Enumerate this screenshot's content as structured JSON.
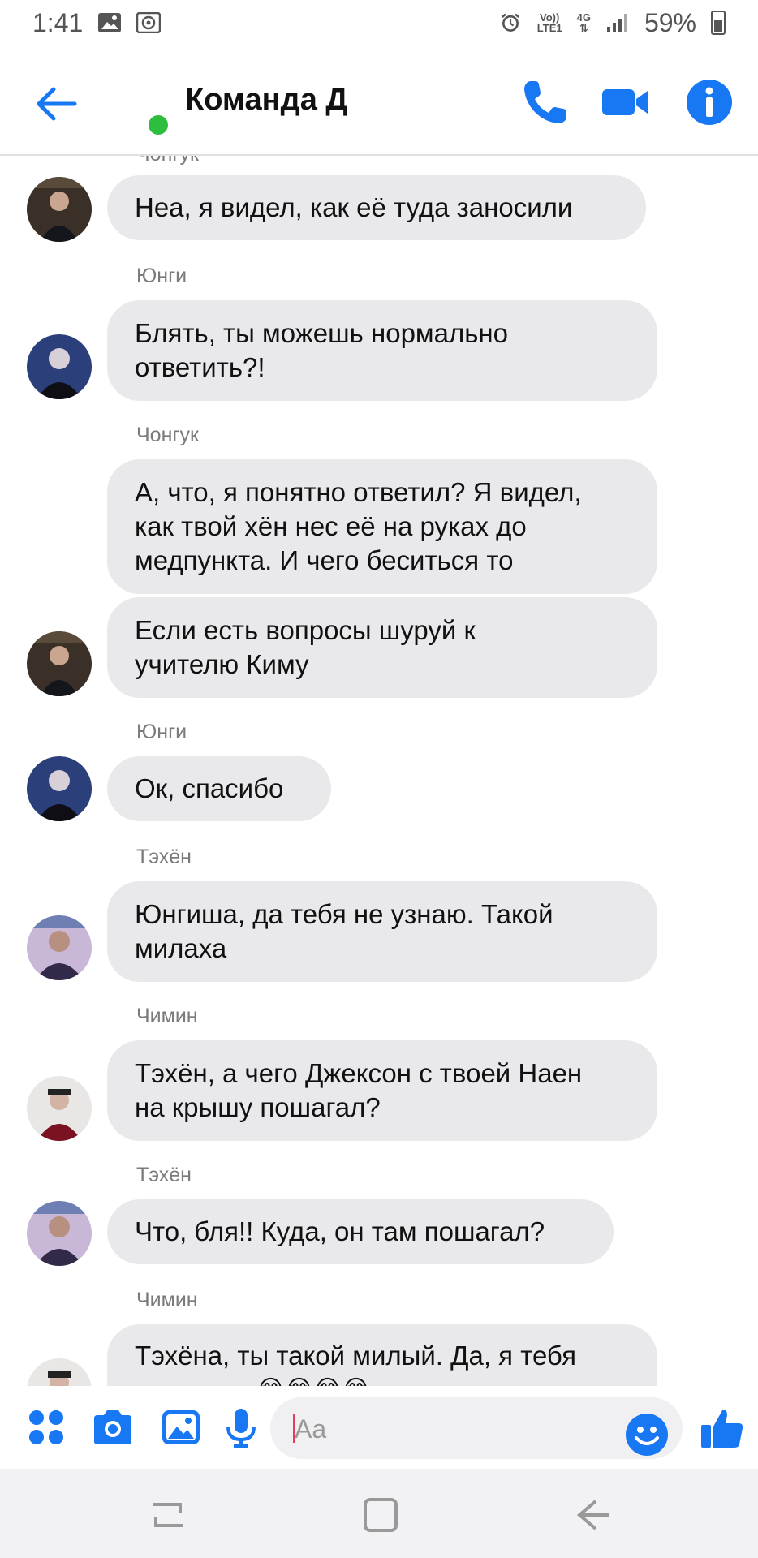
{
  "status_bar": {
    "time": "1:41",
    "net_top": "Vo))",
    "net_bottom": "LTE1",
    "net_4g": "4G",
    "battery": "59%"
  },
  "header": {
    "title": "Команда Д"
  },
  "messages": [
    {
      "sender": "Чонгук",
      "lines": [
        "Неа, я видел, как её туда заносили"
      ]
    },
    {
      "sender": "Юнги",
      "lines": [
        "Блять, ты можешь нормально",
        "ответить?!"
      ]
    },
    {
      "sender": "Чонгук",
      "lines": [
        "А, что, я понятно ответил? Я видел,",
        "как твой хён нес её на руках до",
        "медпункта. И чего беситься то"
      ]
    },
    {
      "sender": "",
      "lines": [
        "Если есть вопросы шуруй к",
        "учителю Киму"
      ]
    },
    {
      "sender": "Юнги",
      "lines": [
        "Ок, спасибо"
      ]
    },
    {
      "sender": "Тэхён",
      "lines": [
        "Юнгиша, да тебя не узнаю. Такой",
        "милаха"
      ]
    },
    {
      "sender": "Чимин",
      "lines": [
        "Тэхён, а чего Джексон с твоей Наен",
        "на крышу пошагал?"
      ]
    },
    {
      "sender": "Тэхён",
      "lines": [
        "Что, бля!! Куда, он там пошагал?"
      ]
    },
    {
      "sender": "Чимин",
      "lines": [
        "Тэхёна, ты такой милый. Да, я тебя"
      ]
    }
  ],
  "composer": {
    "placeholder": "Aa"
  },
  "colors": {
    "accent": "#1877f2",
    "bubble": "#e9e9ec",
    "presence": "#2fbd3e"
  }
}
